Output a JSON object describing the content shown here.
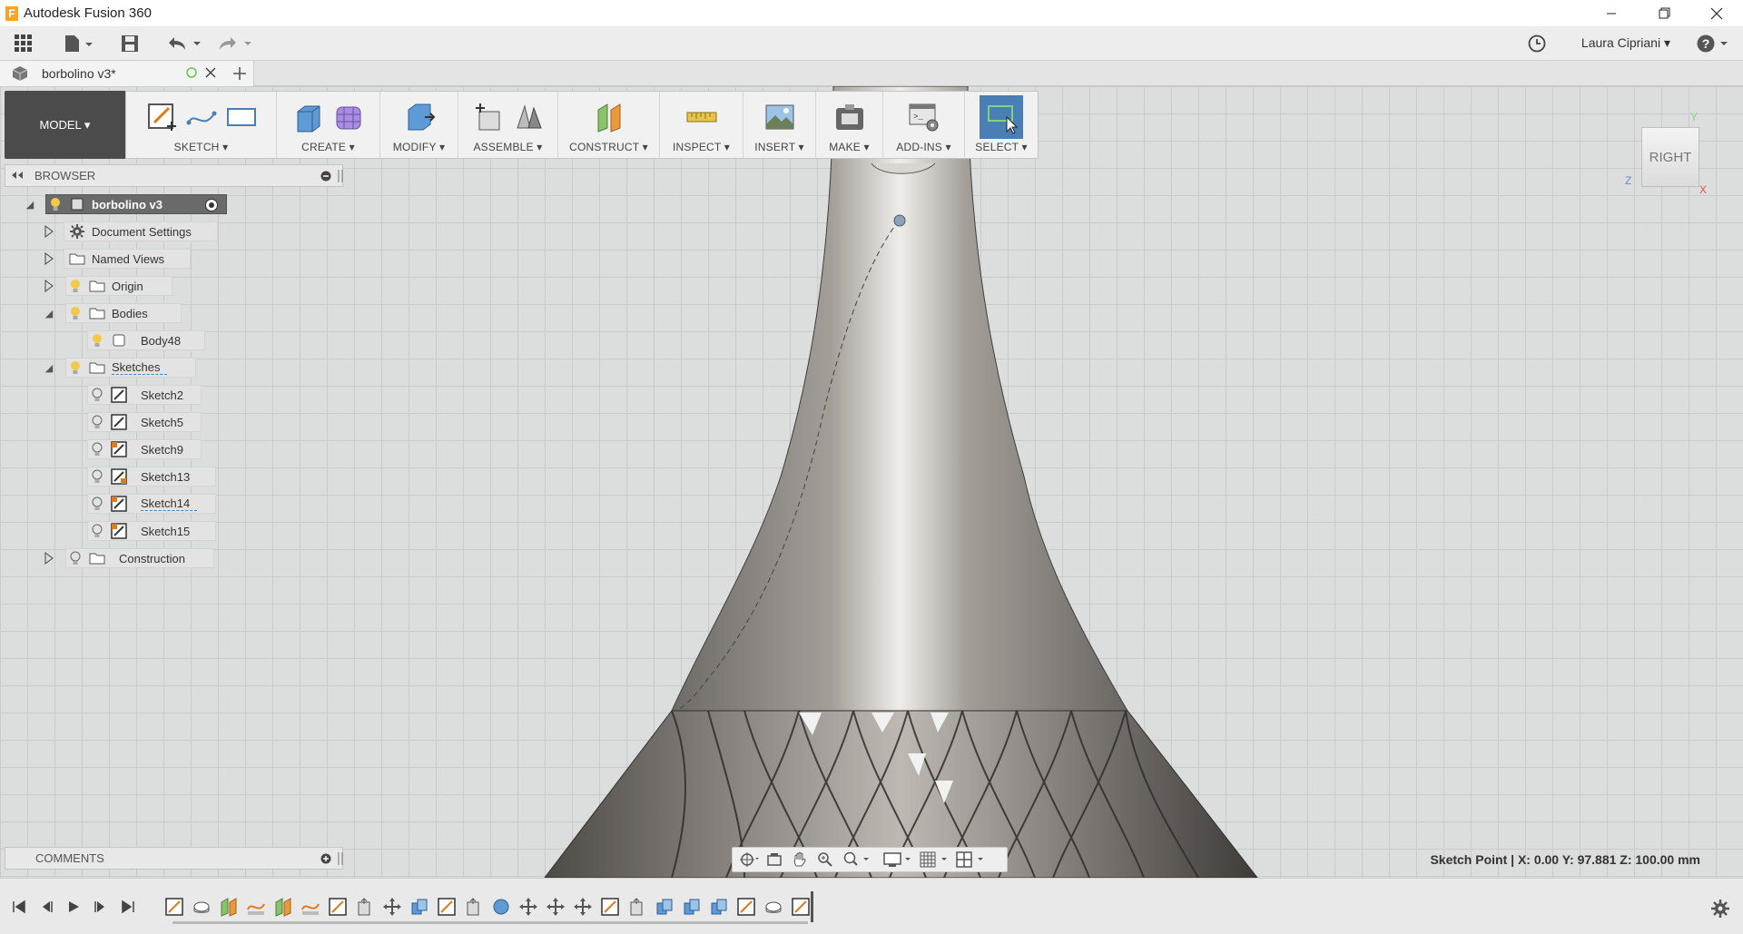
{
  "window": {
    "title": "Autodesk Fusion 360",
    "logo_letter": "F"
  },
  "qat": {
    "user_name": "Laura Cipriani ▾"
  },
  "document_tab": {
    "title": "borbolino v3*"
  },
  "ribbon": {
    "workspace": "MODEL ▾",
    "groups": [
      {
        "label": "SKETCH ▾"
      },
      {
        "label": "CREATE ▾"
      },
      {
        "label": "MODIFY ▾"
      },
      {
        "label": "ASSEMBLE ▾"
      },
      {
        "label": "CONSTRUCT ▾"
      },
      {
        "label": "INSPECT ▾"
      },
      {
        "label": "INSERT ▾"
      },
      {
        "label": "MAKE ▾"
      },
      {
        "label": "ADD-INS ▾"
      },
      {
        "label": "SELECT ▾"
      }
    ]
  },
  "browser": {
    "title": "BROWSER",
    "root": "borbolino v3",
    "items": [
      {
        "label": "Document Settings"
      },
      {
        "label": "Named Views"
      },
      {
        "label": "Origin"
      },
      {
        "label": "Bodies"
      },
      {
        "label": "Body48"
      },
      {
        "label": "Sketches"
      },
      {
        "label": "Sketch2"
      },
      {
        "label": "Sketch5"
      },
      {
        "label": "Sketch9"
      },
      {
        "label": "Sketch13"
      },
      {
        "label": "Sketch14"
      },
      {
        "label": "Sketch15"
      },
      {
        "label": "Construction"
      }
    ]
  },
  "comments": {
    "title": "COMMENTS"
  },
  "viewcube": {
    "face": "RIGHT",
    "axis_y": "Y",
    "axis_z": "Z",
    "axis_x": "X"
  },
  "status": {
    "text": "Sketch Point | X: 0.00 Y: 97.881 Z: 100.00 mm"
  },
  "colors": {
    "accent": "#4a7fb5",
    "bulb": "#f2c94c",
    "sketch_icon": "#e07b1a"
  }
}
